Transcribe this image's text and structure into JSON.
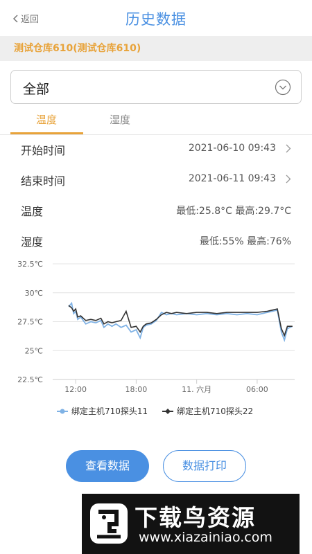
{
  "header": {
    "back_label": "返回",
    "title": "历史数据"
  },
  "warehouse_name": "测试仓库610(测试仓库610)",
  "select": {
    "value": "全部"
  },
  "tabs": [
    {
      "label": "温度",
      "active": true
    },
    {
      "label": "湿度",
      "active": false
    }
  ],
  "colors": {
    "accent": "#e8a33a",
    "brand": "#4a90e2",
    "series1": "#7fb2e5",
    "series2": "#333333"
  },
  "rows": {
    "start": {
      "label": "开始时间",
      "value": "2021-06-10 09:43"
    },
    "end": {
      "label": "结束时间",
      "value": "2021-06-11 09:43"
    },
    "temperature": {
      "label": "温度",
      "value": "最低:25.8°C  最高:29.7°C"
    },
    "humidity": {
      "label": "湿度",
      "value": "最低:55%  最高:76%"
    }
  },
  "chart_data": {
    "type": "line",
    "ylim": [
      22.5,
      32.5
    ],
    "yticks": [
      22.5,
      25,
      27.5,
      30,
      32.5
    ],
    "ytick_labels": [
      "22.5℃",
      "25℃",
      "27.5℃",
      "30℃",
      "32.5℃"
    ],
    "xlim": [
      9.72,
      33.72
    ],
    "xticks": [
      12,
      18,
      24,
      30
    ],
    "xtick_labels": [
      "12:00",
      "18:00",
      "11. 六月",
      "06:00"
    ],
    "grid": "horizontal",
    "legend_position": "bottom",
    "series": [
      {
        "name": "绑定主机710探头11",
        "x": [
          11.3,
          11.6,
          11.8,
          12.0,
          12.2,
          12.5,
          13.0,
          13.5,
          14.0,
          14.5,
          14.8,
          15.2,
          15.6,
          16.0,
          16.5,
          17.0,
          17.5,
          18.0,
          18.4,
          18.7,
          19.0,
          19.5,
          20.0,
          20.5,
          21.0,
          21.5,
          22.0,
          23.0,
          24.0,
          25.0,
          26.0,
          27.0,
          28.0,
          29.0,
          30.0,
          31.0,
          31.5,
          32.0,
          32.4,
          32.7,
          33.0,
          33.5
        ],
        "values": [
          28.8,
          29.1,
          28.2,
          28.4,
          27.7,
          27.9,
          27.3,
          27.5,
          27.4,
          27.6,
          27.0,
          27.3,
          27.1,
          27.3,
          27.0,
          27.2,
          26.6,
          26.8,
          26.1,
          27.0,
          27.2,
          27.3,
          27.6,
          28.3,
          28.1,
          28.2,
          28.1,
          28.2,
          28.1,
          28.2,
          28.1,
          28.2,
          28.1,
          28.2,
          28.1,
          28.3,
          28.4,
          28.5,
          26.6,
          25.9,
          26.9,
          27.1
        ]
      },
      {
        "name": "绑定主机710探头22",
        "x": [
          11.3,
          11.6,
          11.8,
          12.0,
          12.2,
          12.5,
          13.0,
          13.5,
          14.0,
          14.5,
          14.8,
          15.2,
          15.6,
          16.0,
          16.5,
          17.0,
          17.5,
          18.0,
          18.4,
          18.7,
          19.0,
          19.5,
          20.0,
          20.5,
          21.0,
          21.5,
          22.0,
          23.0,
          24.0,
          25.0,
          26.0,
          27.0,
          28.0,
          29.0,
          30.0,
          31.0,
          31.5,
          32.0,
          32.4,
          32.7,
          33.0,
          33.5
        ],
        "values": [
          28.9,
          28.7,
          28.4,
          28.6,
          27.9,
          28.0,
          27.6,
          27.7,
          27.6,
          27.8,
          27.3,
          27.5,
          27.4,
          27.5,
          27.6,
          28.4,
          27.0,
          27.1,
          26.6,
          27.1,
          27.3,
          27.4,
          27.7,
          28.1,
          28.3,
          28.2,
          28.3,
          28.2,
          28.3,
          28.3,
          28.2,
          28.3,
          28.3,
          28.3,
          28.3,
          28.4,
          28.5,
          28.6,
          26.9,
          26.3,
          27.1,
          27.1
        ]
      }
    ]
  },
  "buttons": {
    "view_label": "查看数据",
    "print_label": "数据打印"
  },
  "watermark": {
    "cn": "下载鸟资源",
    "url": "www.xiazainiao.com"
  }
}
